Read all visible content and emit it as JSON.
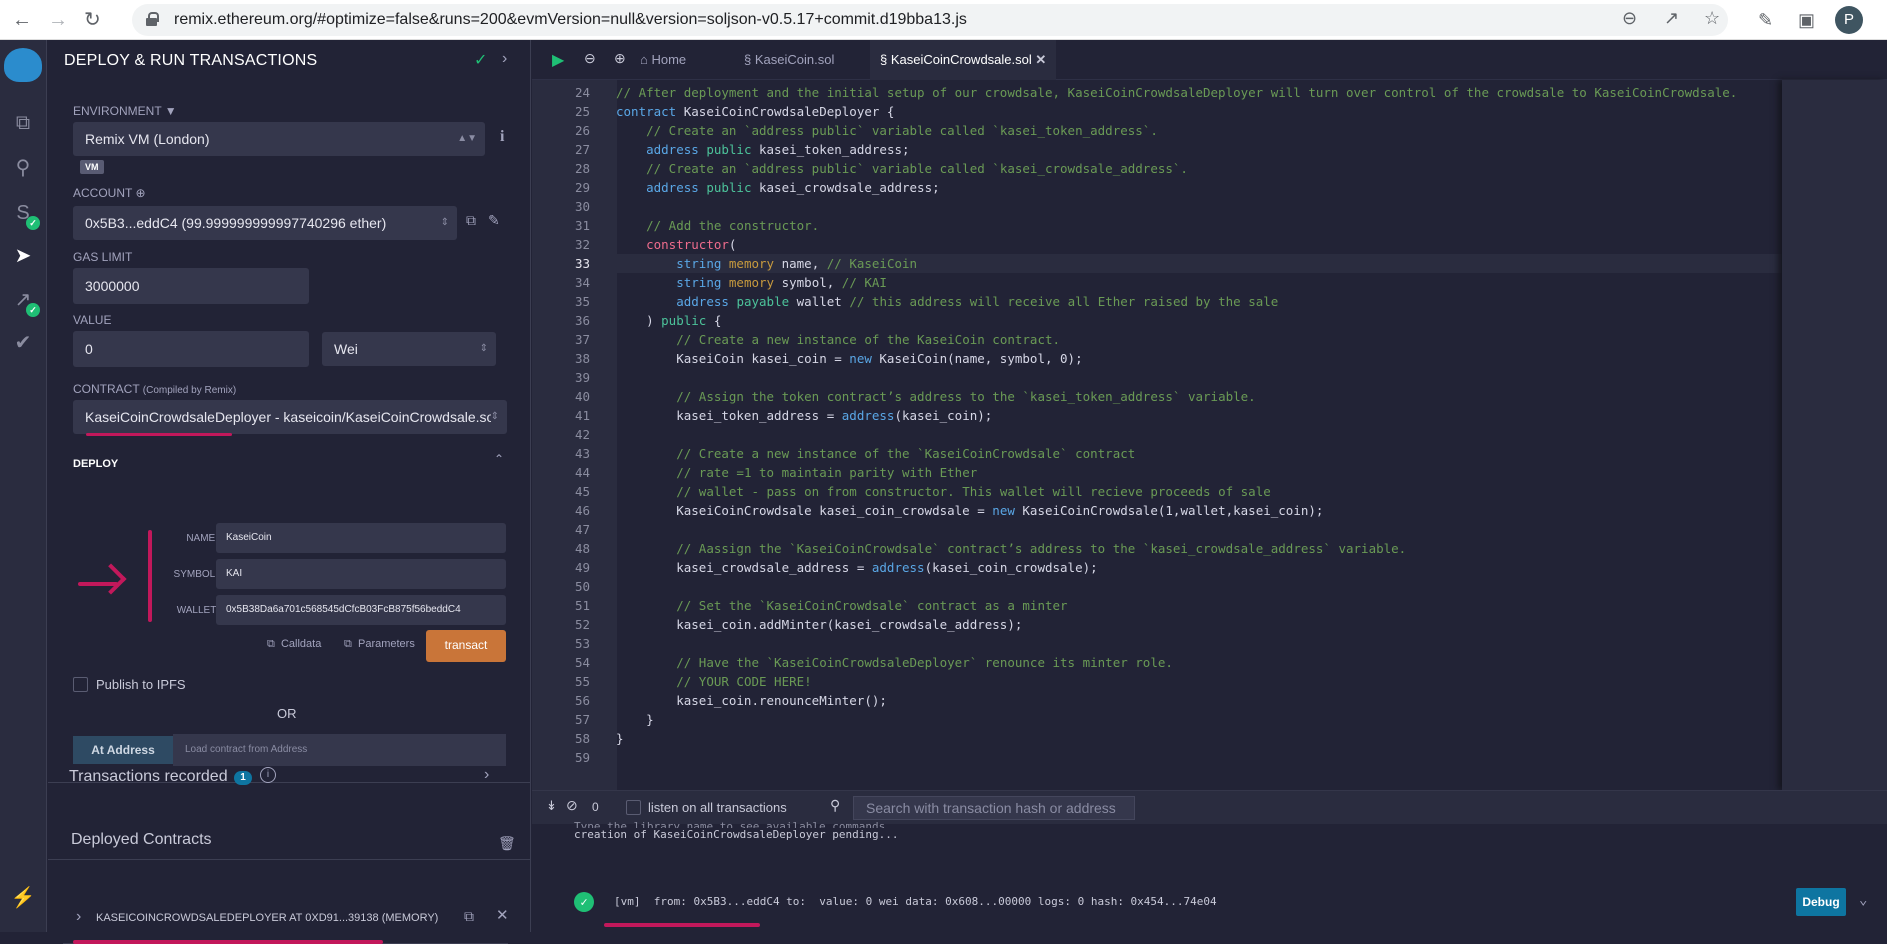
{
  "browser": {
    "url": "remix.ethereum.org/#optimize=false&runs=200&evmVersion=null&version=soljson-v0.5.17+commit.d19bba13.js",
    "profile_initial": "P"
  },
  "side_panel": {
    "title": "DEPLOY & RUN TRANSACTIONS",
    "environment_label": "ENVIRONMENT",
    "environment_value": "Remix VM (London)",
    "vm_badge": "VM",
    "account_label": "ACCOUNT",
    "account_value": "0x5B3...eddC4 (99.999999999997740296 ether)",
    "gas_limit_label": "GAS LIMIT",
    "gas_limit_value": "3000000",
    "value_label": "VALUE",
    "value_amount": "0",
    "value_unit": "Wei",
    "contract_label": "CONTRACT",
    "contract_sublabel": "(Compiled by Remix)",
    "contract_value": "KaseiCoinCrowdsaleDeployer - kaseicoin/KaseiCoinCrowdsale.sol",
    "deploy_label": "DEPLOY",
    "params": [
      {
        "label": "NAME:",
        "value": "KaseiCoin"
      },
      {
        "label": "SYMBOL:",
        "value": "KAI"
      },
      {
        "label": "WALLET:",
        "value": "0x5B38Da6a701c568545dCfcB03FcB875f56beddC4"
      }
    ],
    "calldata_label": "Calldata",
    "parameters_label": "Parameters",
    "transact_label": "transact",
    "publish_ipfs_label": "Publish to IPFS",
    "or_label": "OR",
    "at_address_label": "At Address",
    "at_address_placeholder": "Load contract from Address",
    "transactions_recorded_label": "Transactions recorded",
    "transactions_recorded_count": "1",
    "deployed_contracts_label": "Deployed Contracts",
    "deployed_contract_item": "KASEICOINCROWDSALEDEPLOYER AT 0XD91...39138 (MEMORY)"
  },
  "editor": {
    "tabs": [
      {
        "label": "Home",
        "active": false
      },
      {
        "label": "KaseiCoin.sol",
        "active": false
      },
      {
        "label": "KaseiCoinCrowdsale.sol",
        "active": true
      }
    ],
    "current_line": 33,
    "lines": [
      {
        "n": "24",
        "code": "// After deployment and the initial setup of our crowdsale, KaseiCoinCrowdsaleDeployer will turn over control of the crowdsale to KaseiCoinCrowdsale."
      },
      {
        "n": "25",
        "code": "contract KaseiCoinCrowdsaleDeployer {"
      },
      {
        "n": "26",
        "code": "    // Create an `address public` variable called `kasei_token_address`."
      },
      {
        "n": "27",
        "code": "    address public kasei_token_address;"
      },
      {
        "n": "28",
        "code": "    // Create an `address public` variable called `kasei_crowdsale_address`."
      },
      {
        "n": "29",
        "code": "    address public kasei_crowdsale_address;"
      },
      {
        "n": "30",
        "code": ""
      },
      {
        "n": "31",
        "code": "    // Add the constructor."
      },
      {
        "n": "32",
        "code": "    constructor("
      },
      {
        "n": "33",
        "code": "        string memory name, // KaseiCoin"
      },
      {
        "n": "34",
        "code": "        string memory symbol, // KAI"
      },
      {
        "n": "35",
        "code": "        address payable wallet // this address will receive all Ether raised by the sale"
      },
      {
        "n": "36",
        "code": "    ) public {"
      },
      {
        "n": "37",
        "code": "        // Create a new instance of the KaseiCoin contract."
      },
      {
        "n": "38",
        "code": "        KaseiCoin kasei_coin = new KaseiCoin(name, symbol, 0);"
      },
      {
        "n": "39",
        "code": ""
      },
      {
        "n": "40",
        "code": "        // Assign the token contract’s address to the `kasei_token_address` variable."
      },
      {
        "n": "41",
        "code": "        kasei_token_address = address(kasei_coin);"
      },
      {
        "n": "42",
        "code": ""
      },
      {
        "n": "43",
        "code": "        // Create a new instance of the `KaseiCoinCrowdsale` contract"
      },
      {
        "n": "44",
        "code": "        // rate =1 to maintain parity with Ether"
      },
      {
        "n": "45",
        "code": "        // wallet - pass on from constructor. This wallet will recieve proceeds of sale"
      },
      {
        "n": "46",
        "code": "        KaseiCoinCrowdsale kasei_coin_crowdsale = new KaseiCoinCrowdsale(1,wallet,kasei_coin);"
      },
      {
        "n": "47",
        "code": ""
      },
      {
        "n": "48",
        "code": "        // Aassign the `KaseiCoinCrowdsale` contract’s address to the `kasei_crowdsale_address` variable."
      },
      {
        "n": "49",
        "code": "        kasei_crowdsale_address = address(kasei_coin_crowdsale);"
      },
      {
        "n": "50",
        "code": ""
      },
      {
        "n": "51",
        "code": "        // Set the `KaseiCoinCrowdsale` contract as a minter"
      },
      {
        "n": "52",
        "code": "        kasei_coin.addMinter(kasei_crowdsale_address);"
      },
      {
        "n": "53",
        "code": ""
      },
      {
        "n": "54",
        "code": "        // Have the `KaseiCoinCrowdsaleDeployer` renounce its minter role."
      },
      {
        "n": "55",
        "code": "        // YOUR CODE HERE!"
      },
      {
        "n": "56",
        "code": "        kasei_coin.renounceMinter();"
      },
      {
        "n": "57",
        "code": "    }"
      },
      {
        "n": "58",
        "code": "}"
      },
      {
        "n": "59",
        "code": ""
      }
    ]
  },
  "terminal": {
    "pending_count": "0",
    "listen_label": "listen on all transactions",
    "search_placeholder": "Search with transaction hash or address",
    "partial_line": "Type the library name to see available commands.",
    "pending_line": "creation of KaseiCoinCrowdsaleDeployer pending...",
    "tx_line": "[vm]  from: 0x5B3...eddC4 to:  value: 0 wei data: 0x608...00000 logs: 0 hash: 0x454...74e04",
    "debug_label": "Debug"
  },
  "colors": {
    "accent_transact": "#c97539",
    "accent_debug": "#0e75a1",
    "success": "#1fbf75",
    "annotation": "#c2185b"
  }
}
